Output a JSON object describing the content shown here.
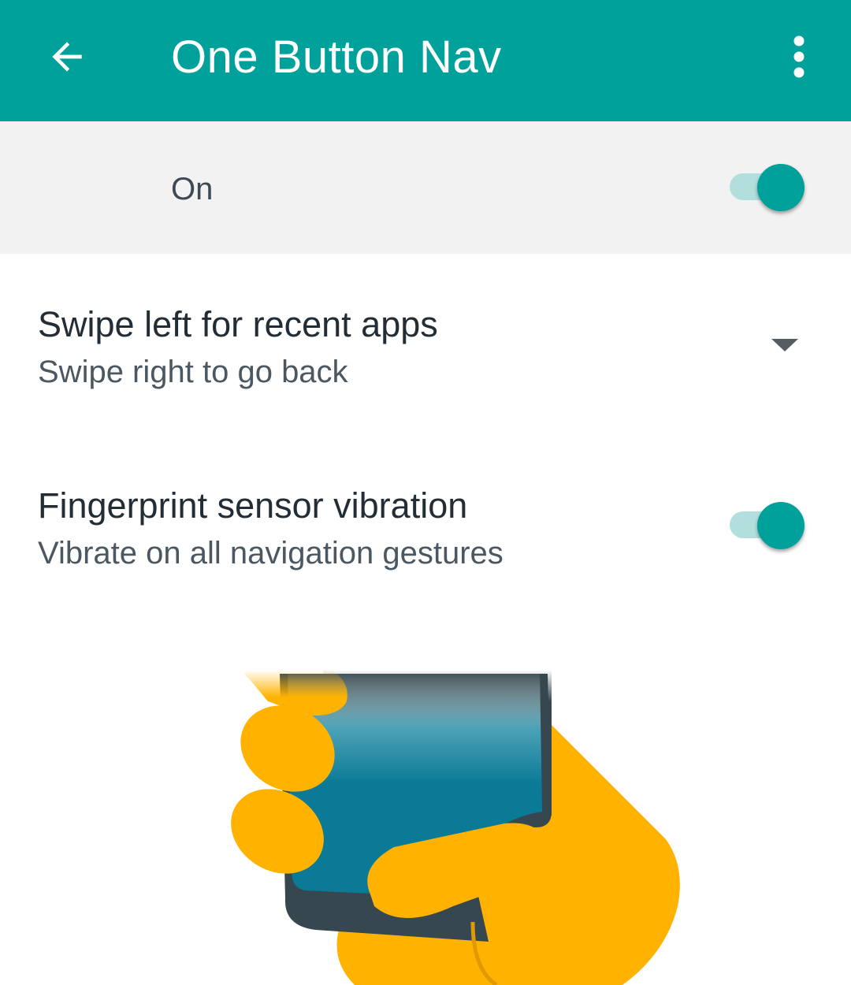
{
  "appbar": {
    "title": "One Button Nav",
    "color": "#00a19a",
    "back_icon": "arrow-back-icon",
    "overflow_icon": "more-vert-icon"
  },
  "master_switch": {
    "label": "On",
    "checked": true
  },
  "preferences": [
    {
      "title": "Swipe left for recent apps",
      "summary": "Swipe right to go back",
      "control": "dropdown",
      "icon": "dropdown-arrow-icon"
    },
    {
      "title": "Fingerprint sensor vibration",
      "summary": "Vibrate on all navigation gestures",
      "control": "switch",
      "checked": true
    }
  ],
  "illustration": {
    "icon": "hand-holding-phone-illustration",
    "colors": {
      "hand": "#ffb300",
      "screen": "#0a7a97",
      "phone_body": "#37474f"
    }
  }
}
